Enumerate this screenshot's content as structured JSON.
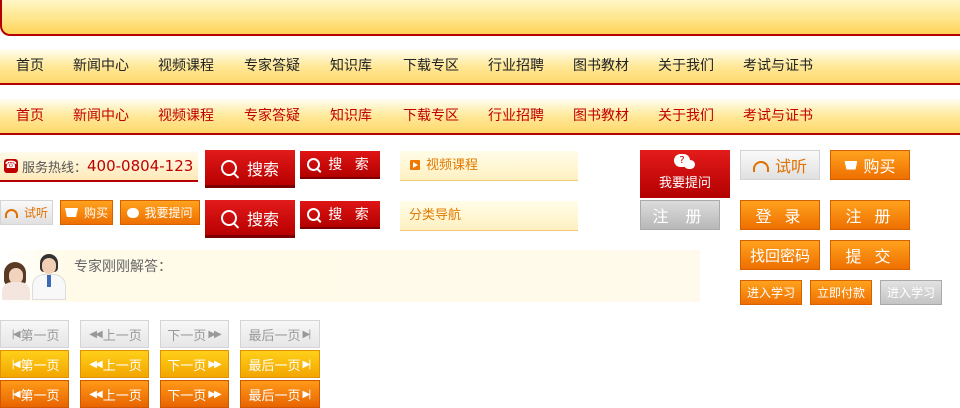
{
  "nav": {
    "items": [
      "首页",
      "新闻中心",
      "视频课程",
      "专家答疑",
      "知识库",
      "下载专区",
      "行业招聘",
      "图书教材",
      "关于我们",
      "考试与证书"
    ]
  },
  "hotline": {
    "label": "服务热线：",
    "number": "400-0804-123"
  },
  "search": {
    "big_label": "搜索",
    "small_label": "搜 索"
  },
  "categories": {
    "video": "视频课程",
    "nav": "分类导航"
  },
  "ask_big_label": "我要提问",
  "register_gray": "注 册",
  "small_buttons": {
    "listen": "试听",
    "buy": "购买",
    "ask": "我要提问"
  },
  "right_buttons": {
    "listen": "试听",
    "buy": "购买",
    "login": "登 录",
    "register": "注 册",
    "forgot": "找回密码",
    "submit": "提 交",
    "enter_study": "进入学习",
    "pay_now": "立即付款",
    "enter_study_disabled": "进入学习"
  },
  "expert": {
    "text": "专家刚刚解答："
  },
  "pager": {
    "first": "第一页",
    "prev": "上一页",
    "next": "下一页",
    "last": "最后一页"
  },
  "colors": {
    "brand_red": "#c00000",
    "orange": "#ee6f00",
    "yellow": "#ffd01a"
  }
}
